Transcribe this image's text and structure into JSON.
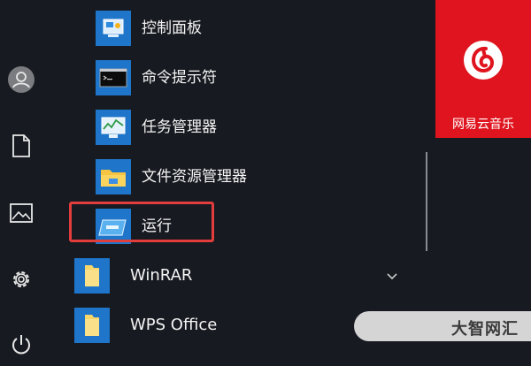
{
  "start_menu": {
    "items": [
      {
        "label": "控制面板",
        "icon": "control-panel-icon"
      },
      {
        "label": "命令提示符",
        "icon": "command-prompt-icon"
      },
      {
        "label": "任务管理器",
        "icon": "task-manager-icon"
      },
      {
        "label": "文件资源管理器",
        "icon": "file-explorer-icon"
      },
      {
        "label": "运行",
        "icon": "run-icon"
      }
    ],
    "groups": [
      {
        "label": "WinRAR",
        "icon": "folder-icon"
      },
      {
        "label": "WPS Office",
        "icon": "folder-icon"
      }
    ]
  },
  "sidebar": {
    "icons": [
      "user-avatar-icon",
      "document-icon",
      "pictures-icon",
      "settings-icon",
      "power-icon"
    ]
  },
  "live_tile": {
    "label": "网易云音乐",
    "color": "#e0141e"
  },
  "watermark": {
    "text": "大智网汇"
  },
  "colors": {
    "background": "#171a20",
    "highlight": "#e23d3d",
    "folder_tile": "#1f75c9"
  }
}
